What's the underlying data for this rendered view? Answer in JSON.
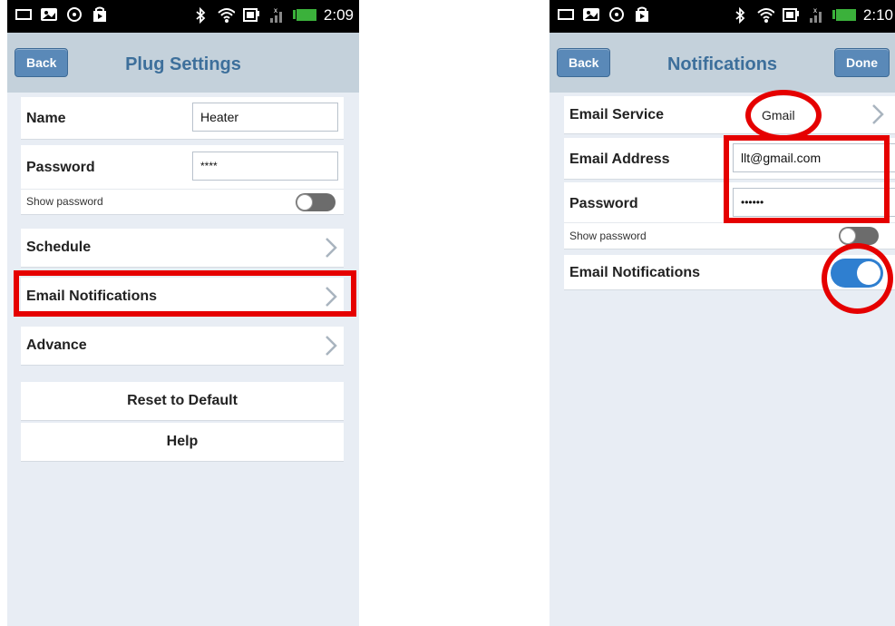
{
  "left_screen": {
    "status_bar": {
      "time": "2:09"
    },
    "header": {
      "back_label": "Back",
      "title": "Plug Settings"
    },
    "name": {
      "label": "Name",
      "value": "Heater"
    },
    "password": {
      "label": "Password",
      "value": "****"
    },
    "show_password": {
      "label": "Show password",
      "enabled": false
    },
    "menu": {
      "schedule": "Schedule",
      "email_notifications": "Email Notifications",
      "advance": "Advance"
    },
    "buttons": {
      "reset": "Reset to Default",
      "help": "Help"
    }
  },
  "right_screen": {
    "status_bar": {
      "time": "2:10"
    },
    "header": {
      "back_label": "Back",
      "title": "Notifications",
      "done_label": "Done"
    },
    "email_service": {
      "label": "Email Service",
      "value": "Gmail"
    },
    "email_address": {
      "label": "Email Address",
      "value": "llt@gmail.com"
    },
    "password": {
      "label": "Password",
      "value": "••••••"
    },
    "show_password": {
      "label": "Show password",
      "enabled": false
    },
    "email_notifications": {
      "label": "Email Notifications",
      "enabled": true
    }
  },
  "colors": {
    "highlight": "#e50000",
    "nav_bar": "#c4d1db",
    "title": "#3d6f9b",
    "button": "#5a89b8",
    "toggle_on": "#2f7fd0"
  }
}
